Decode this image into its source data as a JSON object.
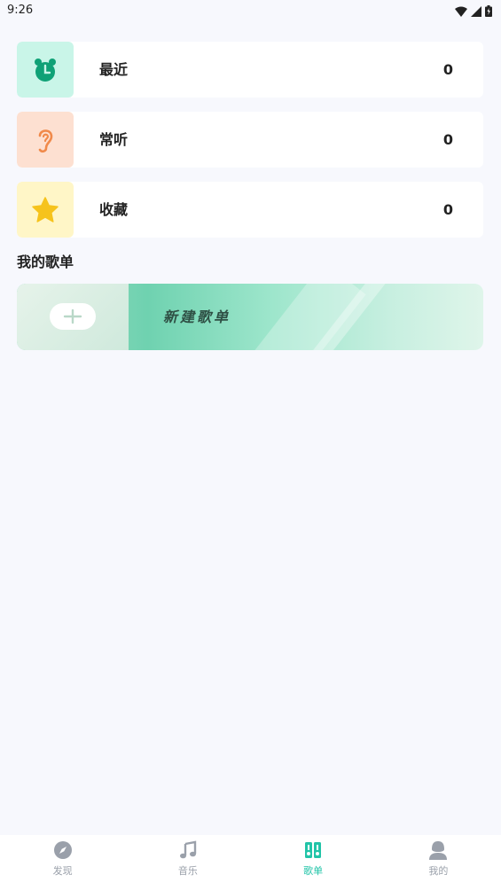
{
  "status_bar": {
    "time": "9:26"
  },
  "stats": [
    {
      "label": "最近",
      "count": "0",
      "icon": "alarm-clock-icon",
      "bg": "#c9f5e8",
      "icon_color": "#0fa176"
    },
    {
      "label": "常听",
      "count": "0",
      "icon": "ear-icon",
      "bg": "#fde0d1",
      "icon_color": "#f08a4b"
    },
    {
      "label": "收藏",
      "count": "0",
      "icon": "star-icon",
      "bg": "#fff6c7",
      "icon_color": "#f6c31c"
    }
  ],
  "section_title": "我的歌单",
  "new_playlist": {
    "label": "新建歌单"
  },
  "tabs": [
    {
      "label": "发现",
      "icon": "compass-icon",
      "active": false
    },
    {
      "label": "音乐",
      "icon": "music-note-icon",
      "active": false
    },
    {
      "label": "歌单",
      "icon": "playlist-icon",
      "active": true
    },
    {
      "label": "我的",
      "icon": "user-icon",
      "active": false
    }
  ],
  "colors": {
    "accent": "#22c4a8",
    "inactive": "#9aa0aa",
    "background": "#f7f8fd"
  }
}
